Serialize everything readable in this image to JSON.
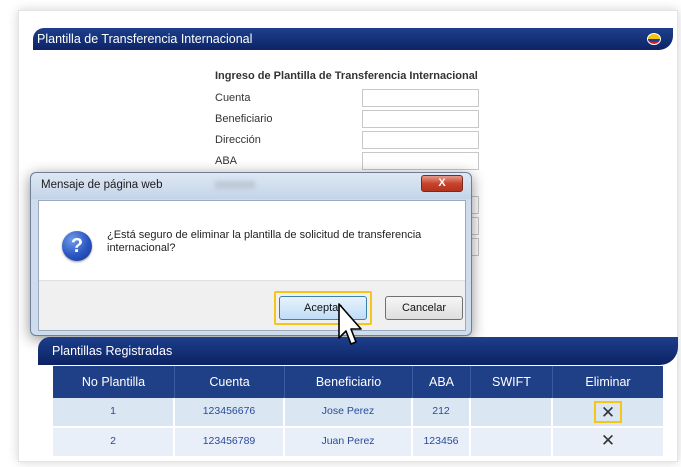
{
  "page": {
    "title": "Plantilla de Transferencia Internacional",
    "form_title": "Ingreso de Plantilla de Transferencia Internacional",
    "fields": [
      {
        "label": "Cuenta"
      },
      {
        "label": "Beneficiario"
      },
      {
        "label": "Dirección"
      },
      {
        "label": "ABA"
      }
    ]
  },
  "dialog": {
    "title": "Mensaje de página web",
    "close_label": "X",
    "message": "¿Está seguro de eliminar la plantilla de solicitud de transferencia internacional?",
    "icon": "question-icon",
    "accept_label": "Aceptar",
    "cancel_label": "Cancelar"
  },
  "registered": {
    "title": "Plantillas Registradas",
    "columns": [
      "No Plantilla",
      "Cuenta",
      "Beneficiario",
      "ABA",
      "SWIFT",
      "Eliminar"
    ],
    "rows": [
      {
        "no": "1",
        "cuenta": "123456676",
        "beneficiario": "Jose Perez",
        "aba": "212",
        "swift": "",
        "delete": "✕"
      },
      {
        "no": "2",
        "cuenta": "123456789",
        "beneficiario": "Juan Perez",
        "aba": "123456",
        "swift": "",
        "delete": "✕"
      }
    ]
  },
  "colors": {
    "header_blue": "#1d3f8c",
    "highlight": "#f5c518",
    "link_blue": "#2a4b9a"
  }
}
